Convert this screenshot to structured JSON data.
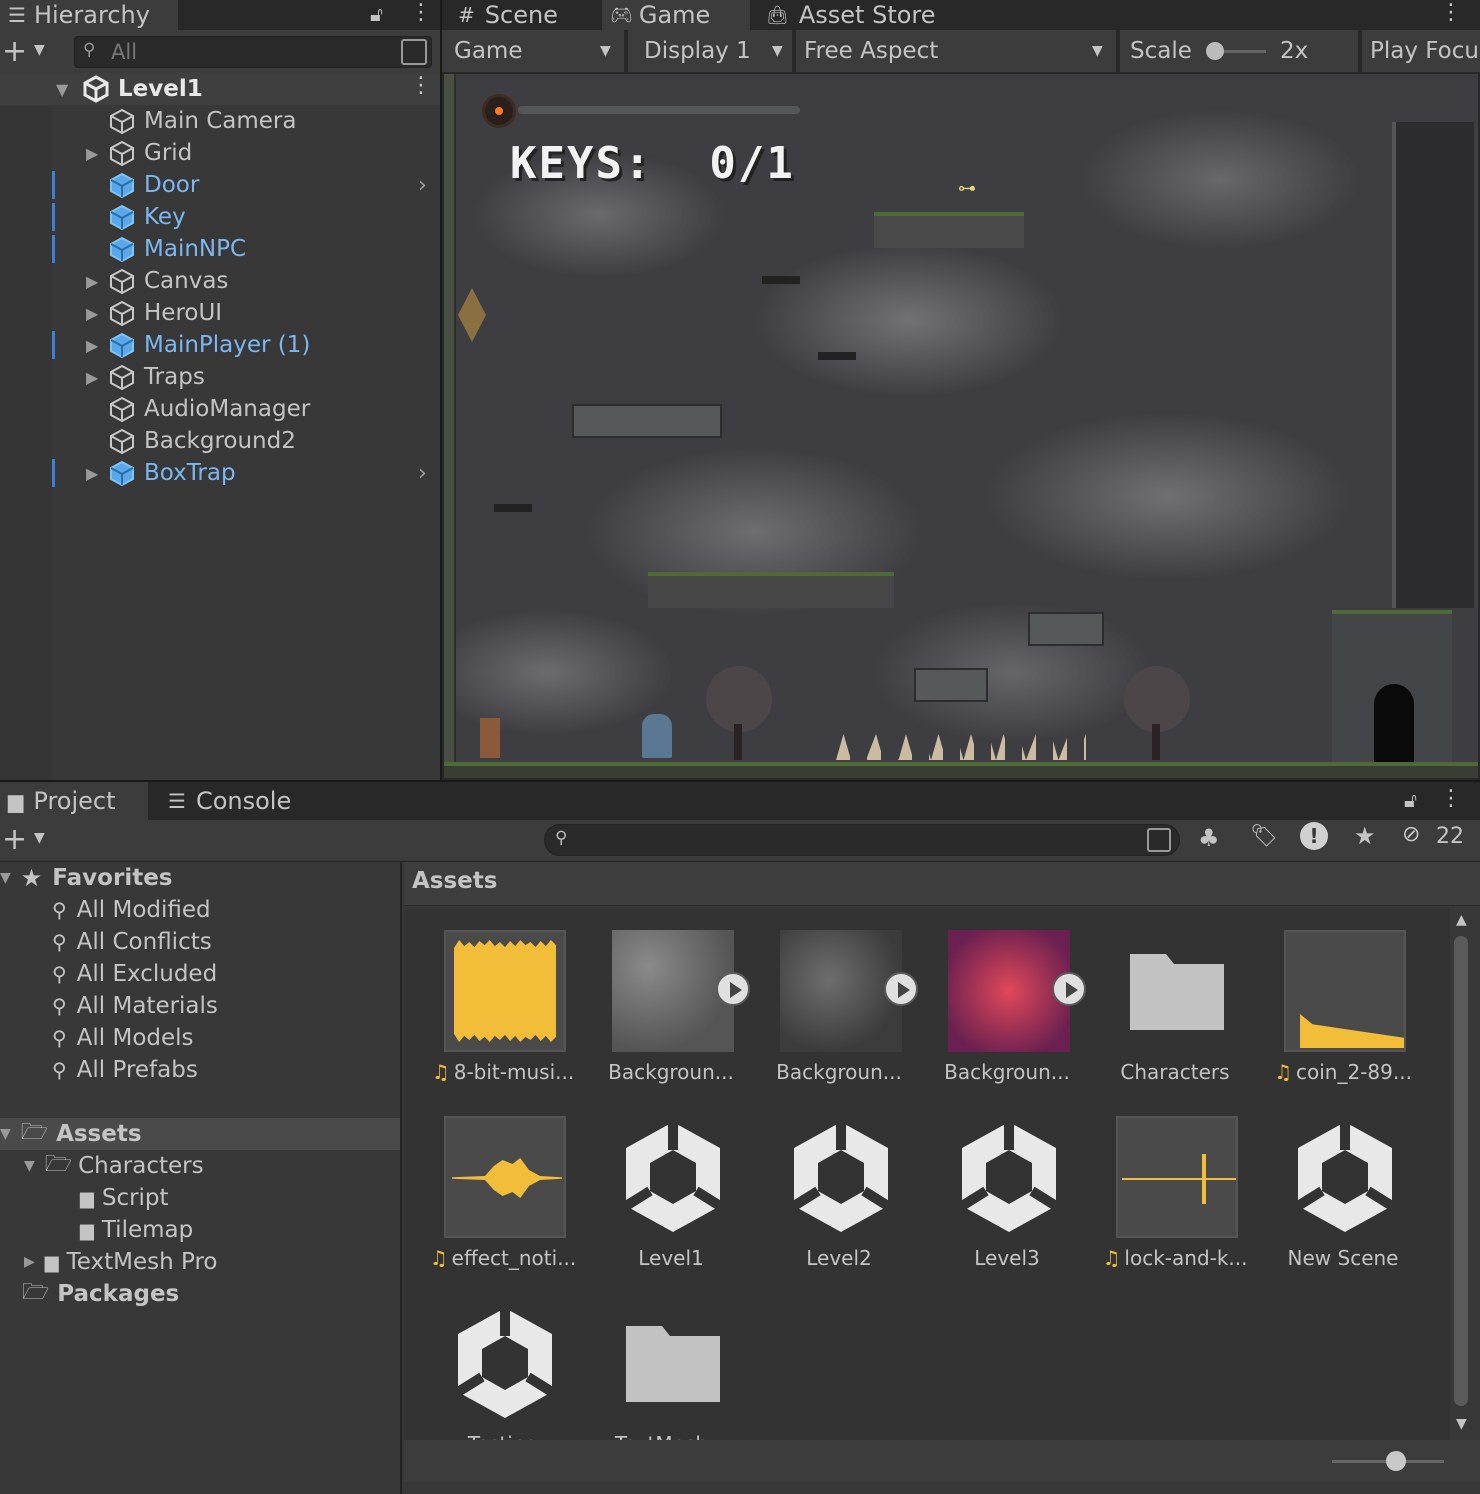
{
  "hierarchy": {
    "tab_label": "Hierarchy",
    "search_placeholder": "All",
    "scene_name": "Level1",
    "items": [
      {
        "label": "Main Camera",
        "prefab": false,
        "expandable": false
      },
      {
        "label": "Grid",
        "prefab": false,
        "expandable": true
      },
      {
        "label": "Door",
        "prefab": true,
        "expandable": false,
        "has_chevron": true
      },
      {
        "label": "Key",
        "prefab": true,
        "expandable": false
      },
      {
        "label": "MainNPC",
        "prefab": true,
        "expandable": false
      },
      {
        "label": "Canvas",
        "prefab": false,
        "expandable": true
      },
      {
        "label": "HeroUI",
        "prefab": false,
        "expandable": true
      },
      {
        "label": "MainPlayer (1)",
        "prefab": true,
        "expandable": true
      },
      {
        "label": "Traps",
        "prefab": false,
        "expandable": true
      },
      {
        "label": "AudioManager",
        "prefab": false,
        "expandable": false
      },
      {
        "label": "Background2",
        "prefab": false,
        "expandable": false
      },
      {
        "label": "BoxTrap",
        "prefab": true,
        "expandable": true,
        "has_chevron": true
      }
    ]
  },
  "game_tabs": [
    {
      "label": "Scene",
      "icon": "grid-icon"
    },
    {
      "label": "Game",
      "icon": "gamepad-icon",
      "active": true
    },
    {
      "label": "Asset Store",
      "icon": "bag-icon"
    }
  ],
  "game_toolbar": {
    "view_select": "Game",
    "display_select": "Display 1",
    "aspect_select": "Free Aspect",
    "scale_label": "Scale",
    "scale_value": "2x",
    "play_focused": "Play Focu"
  },
  "game_hud": {
    "keys_text": "KEYS:  0/1"
  },
  "project_tabs": [
    {
      "label": "Project",
      "icon": "folder-icon",
      "active": true
    },
    {
      "label": "Console",
      "icon": "console-icon"
    }
  ],
  "project_toolbar": {
    "hidden_count": "22"
  },
  "favorites": {
    "label": "Favorites",
    "items": [
      "All Modified",
      "All Conflicts",
      "All Excluded",
      "All Materials",
      "All Models",
      "All Prefabs"
    ]
  },
  "tree": {
    "assets": "Assets",
    "characters": "Characters",
    "script": "Script",
    "tilemap": "Tilemap",
    "textmesh": "TextMesh Pro",
    "packages": "Packages"
  },
  "assets_header": "Assets",
  "assets": [
    {
      "name": "8-bit-musi...",
      "type": "audio-full"
    },
    {
      "name": "Backgroun...",
      "type": "texture-gray",
      "playable": true
    },
    {
      "name": "Backgroun...",
      "type": "texture-dark",
      "playable": true
    },
    {
      "name": "Backgroun...",
      "type": "texture-red",
      "playable": true
    },
    {
      "name": "Characters",
      "type": "folder"
    },
    {
      "name": "coin_2-89...",
      "type": "audio-ramp"
    },
    {
      "name": "effect_noti...",
      "type": "audio-wave"
    },
    {
      "name": "Level1",
      "type": "scene"
    },
    {
      "name": "Level2",
      "type": "scene"
    },
    {
      "name": "Level3",
      "type": "scene"
    },
    {
      "name": "lock-and-k...",
      "type": "audio-spike"
    },
    {
      "name": "New Scene",
      "type": "scene"
    },
    {
      "name": "Testing",
      "type": "scene"
    },
    {
      "name": "TextMesh...",
      "type": "folder"
    }
  ],
  "colors": {
    "prefab_blue": "#7db7f0",
    "audio_yellow": "#f2bd38",
    "panel_bg": "#383838"
  }
}
